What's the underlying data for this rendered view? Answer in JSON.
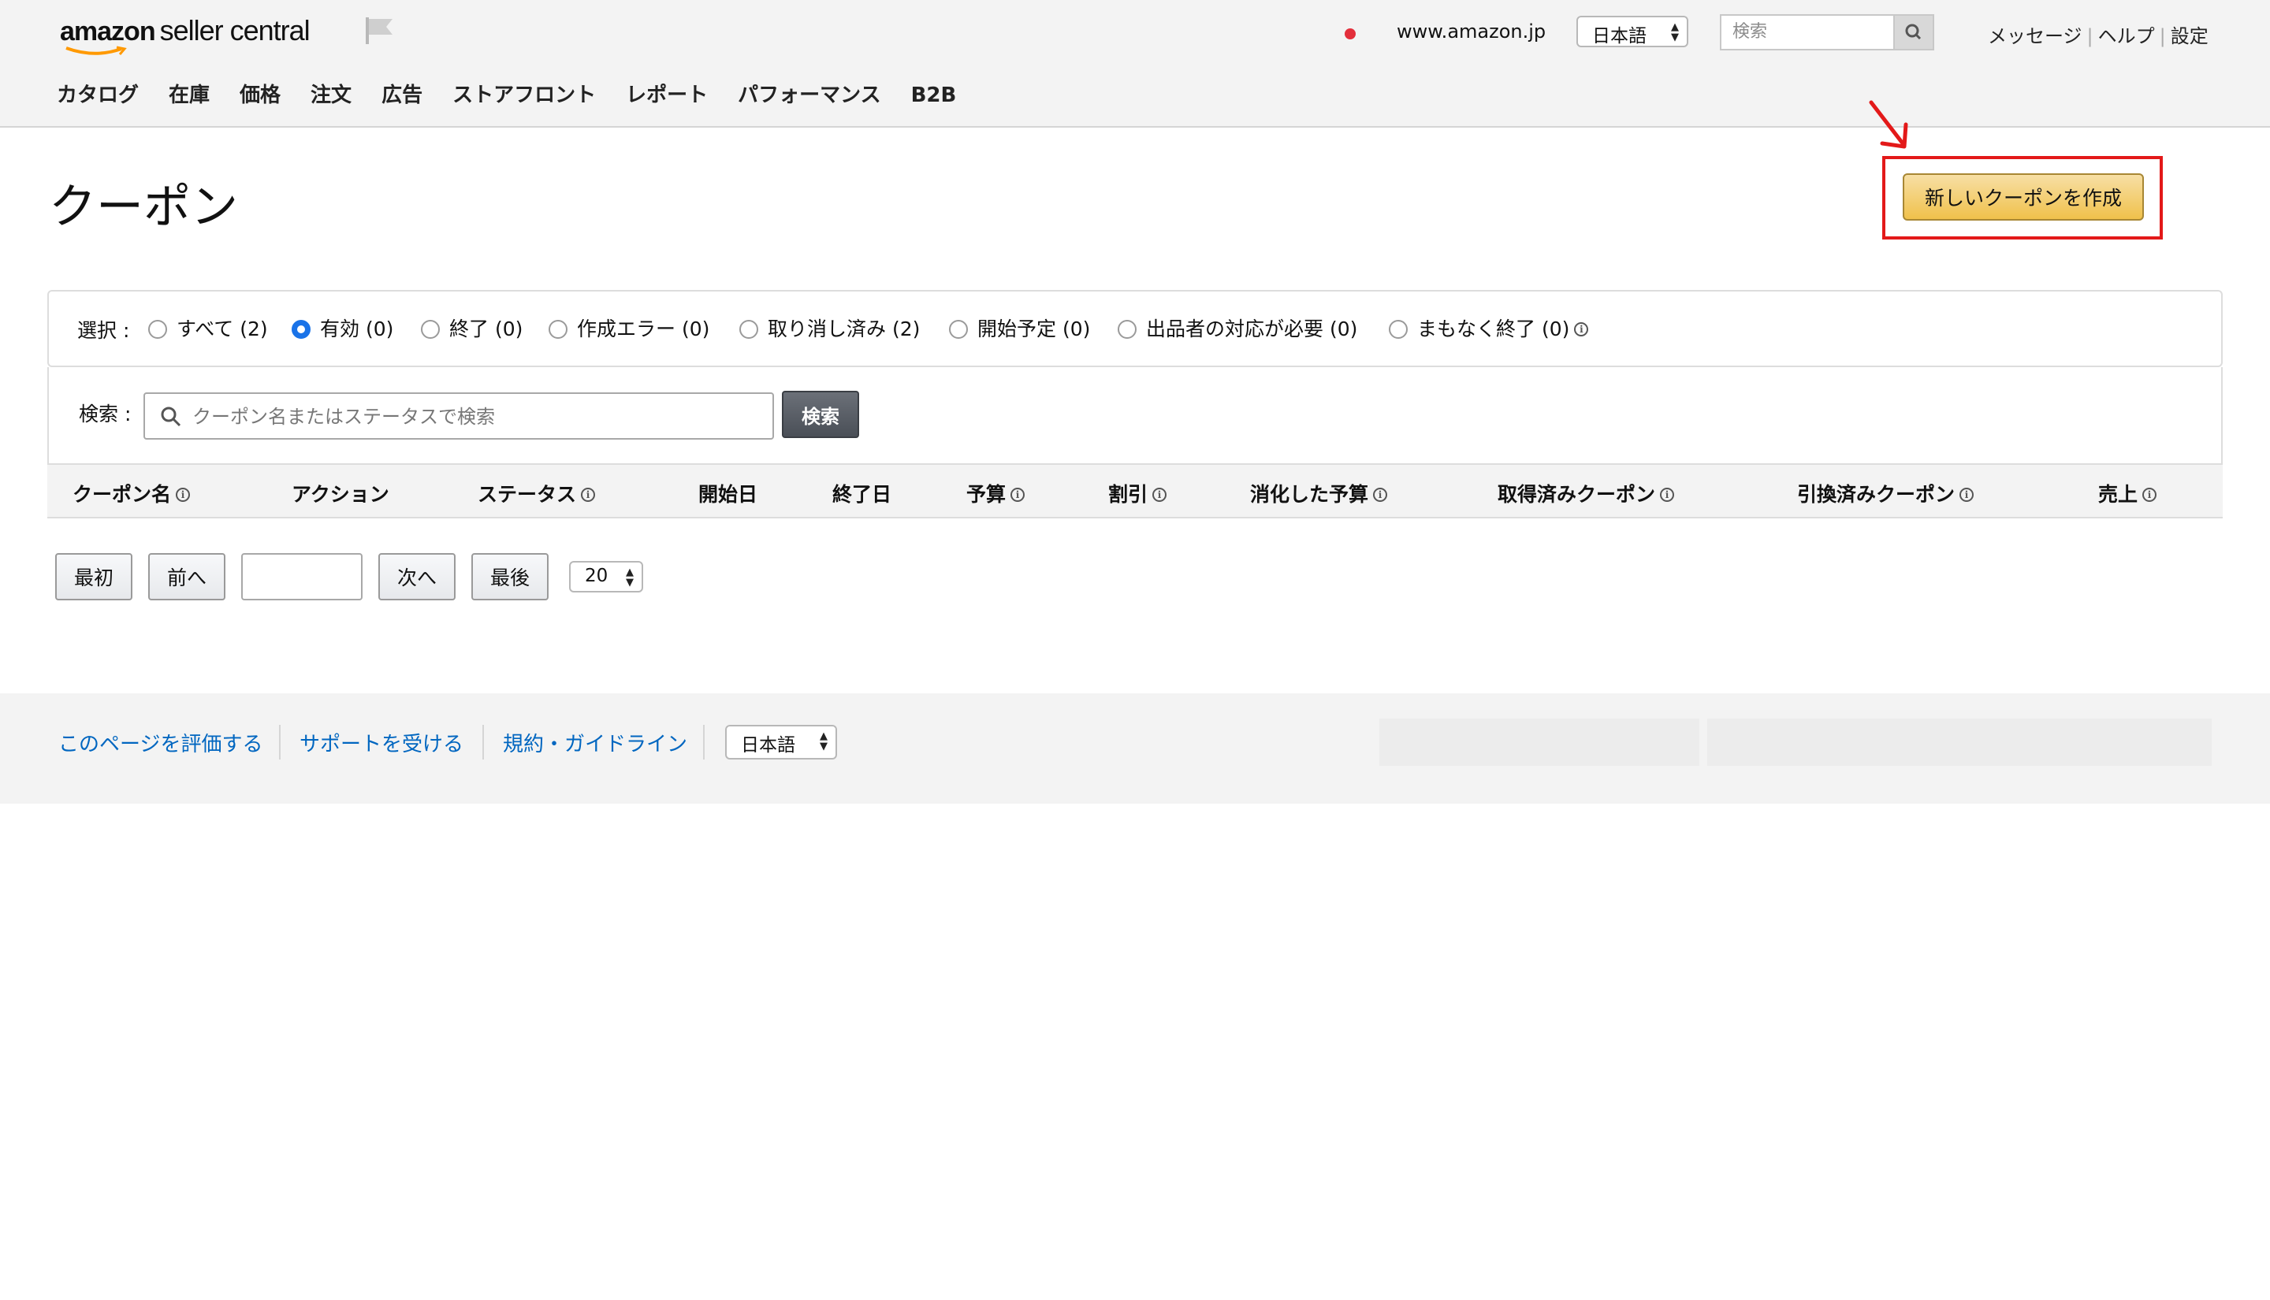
{
  "header": {
    "logo": {
      "brand": "amazon",
      "rest": "seller central"
    },
    "marketplace": "www.amazon.jp",
    "language": "日本語",
    "search_placeholder": "検索",
    "links": [
      "メッセージ",
      "ヘルプ",
      "設定"
    ],
    "nav": [
      "カタログ",
      "在庫",
      "価格",
      "注文",
      "広告",
      "ストアフロント",
      "レポート",
      "パフォーマンス",
      "B2B"
    ]
  },
  "page": {
    "title": "クーポン",
    "create_button": "新しいクーポンを作成"
  },
  "filter": {
    "label": "選択 :",
    "options": [
      {
        "label": "すべて (2)",
        "selected": false
      },
      {
        "label": "有効 (0)",
        "selected": true
      },
      {
        "label": "終了 (0)",
        "selected": false
      },
      {
        "label": "作成エラー (0)",
        "selected": false
      },
      {
        "label": "取り消し済み (2)",
        "selected": false
      },
      {
        "label": "開始予定 (0)",
        "selected": false
      },
      {
        "label": "出品者の対応が必要 (0)",
        "selected": false
      },
      {
        "label": "まもなく終了 (0)",
        "selected": false
      }
    ]
  },
  "search": {
    "label": "検索 :",
    "placeholder": "クーポン名またはステータスで検索",
    "value": "",
    "button": "検索"
  },
  "table": {
    "columns": [
      {
        "label": "クーポン名",
        "info": true
      },
      {
        "label": "アクション",
        "info": false
      },
      {
        "label": "ステータス",
        "info": true
      },
      {
        "label": "開始日",
        "info": false
      },
      {
        "label": "終了日",
        "info": false
      },
      {
        "label": "予算",
        "info": true
      },
      {
        "label": "割引",
        "info": true
      },
      {
        "label": "消化した予算",
        "info": true
      },
      {
        "label": "取得済みクーポン",
        "info": true
      },
      {
        "label": "引換済みクーポン",
        "info": true
      },
      {
        "label": "売上",
        "info": true
      }
    ]
  },
  "pagination": {
    "first": "最初",
    "prev": "前へ",
    "page_value": "",
    "next": "次へ",
    "last": "最後",
    "page_size": "20"
  },
  "footer": {
    "links": [
      "このページを評価する",
      "サポートを受ける",
      "規約・ガイドライン"
    ],
    "language": "日本語"
  },
  "colors": {
    "primary_button": "#f0c14b",
    "annotation": "#e31919",
    "link": "#0066c0",
    "radio_selected": "#1a73e8"
  }
}
